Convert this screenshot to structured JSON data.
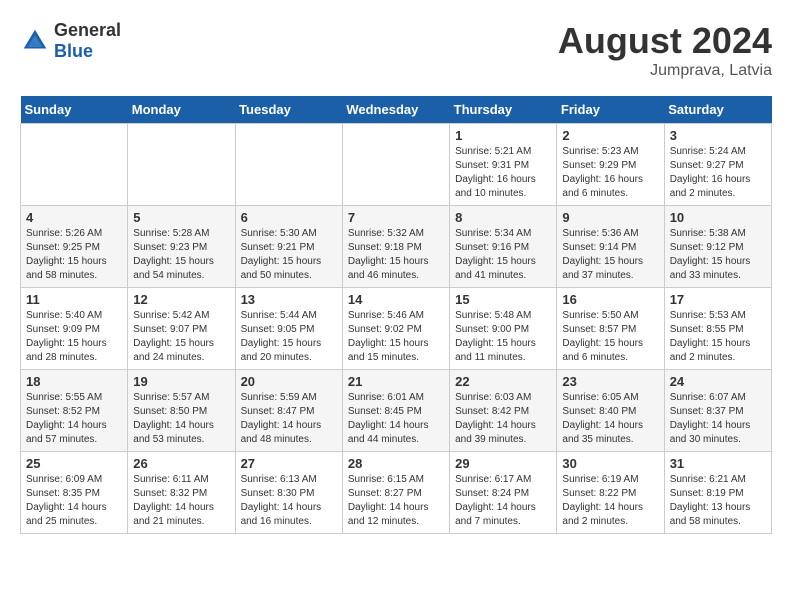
{
  "header": {
    "logo_general": "General",
    "logo_blue": "Blue",
    "month_year": "August 2024",
    "location": "Jumprava, Latvia"
  },
  "days_of_week": [
    "Sunday",
    "Monday",
    "Tuesday",
    "Wednesday",
    "Thursday",
    "Friday",
    "Saturday"
  ],
  "weeks": [
    [
      {
        "day": "",
        "sunrise": "",
        "sunset": "",
        "daylight": ""
      },
      {
        "day": "",
        "sunrise": "",
        "sunset": "",
        "daylight": ""
      },
      {
        "day": "",
        "sunrise": "",
        "sunset": "",
        "daylight": ""
      },
      {
        "day": "",
        "sunrise": "",
        "sunset": "",
        "daylight": ""
      },
      {
        "day": "1",
        "sunrise": "Sunrise: 5:21 AM",
        "sunset": "Sunset: 9:31 PM",
        "daylight": "Daylight: 16 hours and 10 minutes."
      },
      {
        "day": "2",
        "sunrise": "Sunrise: 5:23 AM",
        "sunset": "Sunset: 9:29 PM",
        "daylight": "Daylight: 16 hours and 6 minutes."
      },
      {
        "day": "3",
        "sunrise": "Sunrise: 5:24 AM",
        "sunset": "Sunset: 9:27 PM",
        "daylight": "Daylight: 16 hours and 2 minutes."
      }
    ],
    [
      {
        "day": "4",
        "sunrise": "Sunrise: 5:26 AM",
        "sunset": "Sunset: 9:25 PM",
        "daylight": "Daylight: 15 hours and 58 minutes."
      },
      {
        "day": "5",
        "sunrise": "Sunrise: 5:28 AM",
        "sunset": "Sunset: 9:23 PM",
        "daylight": "Daylight: 15 hours and 54 minutes."
      },
      {
        "day": "6",
        "sunrise": "Sunrise: 5:30 AM",
        "sunset": "Sunset: 9:21 PM",
        "daylight": "Daylight: 15 hours and 50 minutes."
      },
      {
        "day": "7",
        "sunrise": "Sunrise: 5:32 AM",
        "sunset": "Sunset: 9:18 PM",
        "daylight": "Daylight: 15 hours and 46 minutes."
      },
      {
        "day": "8",
        "sunrise": "Sunrise: 5:34 AM",
        "sunset": "Sunset: 9:16 PM",
        "daylight": "Daylight: 15 hours and 41 minutes."
      },
      {
        "day": "9",
        "sunrise": "Sunrise: 5:36 AM",
        "sunset": "Sunset: 9:14 PM",
        "daylight": "Daylight: 15 hours and 37 minutes."
      },
      {
        "day": "10",
        "sunrise": "Sunrise: 5:38 AM",
        "sunset": "Sunset: 9:12 PM",
        "daylight": "Daylight: 15 hours and 33 minutes."
      }
    ],
    [
      {
        "day": "11",
        "sunrise": "Sunrise: 5:40 AM",
        "sunset": "Sunset: 9:09 PM",
        "daylight": "Daylight: 15 hours and 28 minutes."
      },
      {
        "day": "12",
        "sunrise": "Sunrise: 5:42 AM",
        "sunset": "Sunset: 9:07 PM",
        "daylight": "Daylight: 15 hours and 24 minutes."
      },
      {
        "day": "13",
        "sunrise": "Sunrise: 5:44 AM",
        "sunset": "Sunset: 9:05 PM",
        "daylight": "Daylight: 15 hours and 20 minutes."
      },
      {
        "day": "14",
        "sunrise": "Sunrise: 5:46 AM",
        "sunset": "Sunset: 9:02 PM",
        "daylight": "Daylight: 15 hours and 15 minutes."
      },
      {
        "day": "15",
        "sunrise": "Sunrise: 5:48 AM",
        "sunset": "Sunset: 9:00 PM",
        "daylight": "Daylight: 15 hours and 11 minutes."
      },
      {
        "day": "16",
        "sunrise": "Sunrise: 5:50 AM",
        "sunset": "Sunset: 8:57 PM",
        "daylight": "Daylight: 15 hours and 6 minutes."
      },
      {
        "day": "17",
        "sunrise": "Sunrise: 5:53 AM",
        "sunset": "Sunset: 8:55 PM",
        "daylight": "Daylight: 15 hours and 2 minutes."
      }
    ],
    [
      {
        "day": "18",
        "sunrise": "Sunrise: 5:55 AM",
        "sunset": "Sunset: 8:52 PM",
        "daylight": "Daylight: 14 hours and 57 minutes."
      },
      {
        "day": "19",
        "sunrise": "Sunrise: 5:57 AM",
        "sunset": "Sunset: 8:50 PM",
        "daylight": "Daylight: 14 hours and 53 minutes."
      },
      {
        "day": "20",
        "sunrise": "Sunrise: 5:59 AM",
        "sunset": "Sunset: 8:47 PM",
        "daylight": "Daylight: 14 hours and 48 minutes."
      },
      {
        "day": "21",
        "sunrise": "Sunrise: 6:01 AM",
        "sunset": "Sunset: 8:45 PM",
        "daylight": "Daylight: 14 hours and 44 minutes."
      },
      {
        "day": "22",
        "sunrise": "Sunrise: 6:03 AM",
        "sunset": "Sunset: 8:42 PM",
        "daylight": "Daylight: 14 hours and 39 minutes."
      },
      {
        "day": "23",
        "sunrise": "Sunrise: 6:05 AM",
        "sunset": "Sunset: 8:40 PM",
        "daylight": "Daylight: 14 hours and 35 minutes."
      },
      {
        "day": "24",
        "sunrise": "Sunrise: 6:07 AM",
        "sunset": "Sunset: 8:37 PM",
        "daylight": "Daylight: 14 hours and 30 minutes."
      }
    ],
    [
      {
        "day": "25",
        "sunrise": "Sunrise: 6:09 AM",
        "sunset": "Sunset: 8:35 PM",
        "daylight": "Daylight: 14 hours and 25 minutes."
      },
      {
        "day": "26",
        "sunrise": "Sunrise: 6:11 AM",
        "sunset": "Sunset: 8:32 PM",
        "daylight": "Daylight: 14 hours and 21 minutes."
      },
      {
        "day": "27",
        "sunrise": "Sunrise: 6:13 AM",
        "sunset": "Sunset: 8:30 PM",
        "daylight": "Daylight: 14 hours and 16 minutes."
      },
      {
        "day": "28",
        "sunrise": "Sunrise: 6:15 AM",
        "sunset": "Sunset: 8:27 PM",
        "daylight": "Daylight: 14 hours and 12 minutes."
      },
      {
        "day": "29",
        "sunrise": "Sunrise: 6:17 AM",
        "sunset": "Sunset: 8:24 PM",
        "daylight": "Daylight: 14 hours and 7 minutes."
      },
      {
        "day": "30",
        "sunrise": "Sunrise: 6:19 AM",
        "sunset": "Sunset: 8:22 PM",
        "daylight": "Daylight: 14 hours and 2 minutes."
      },
      {
        "day": "31",
        "sunrise": "Sunrise: 6:21 AM",
        "sunset": "Sunset: 8:19 PM",
        "daylight": "Daylight: 13 hours and 58 minutes."
      }
    ]
  ]
}
